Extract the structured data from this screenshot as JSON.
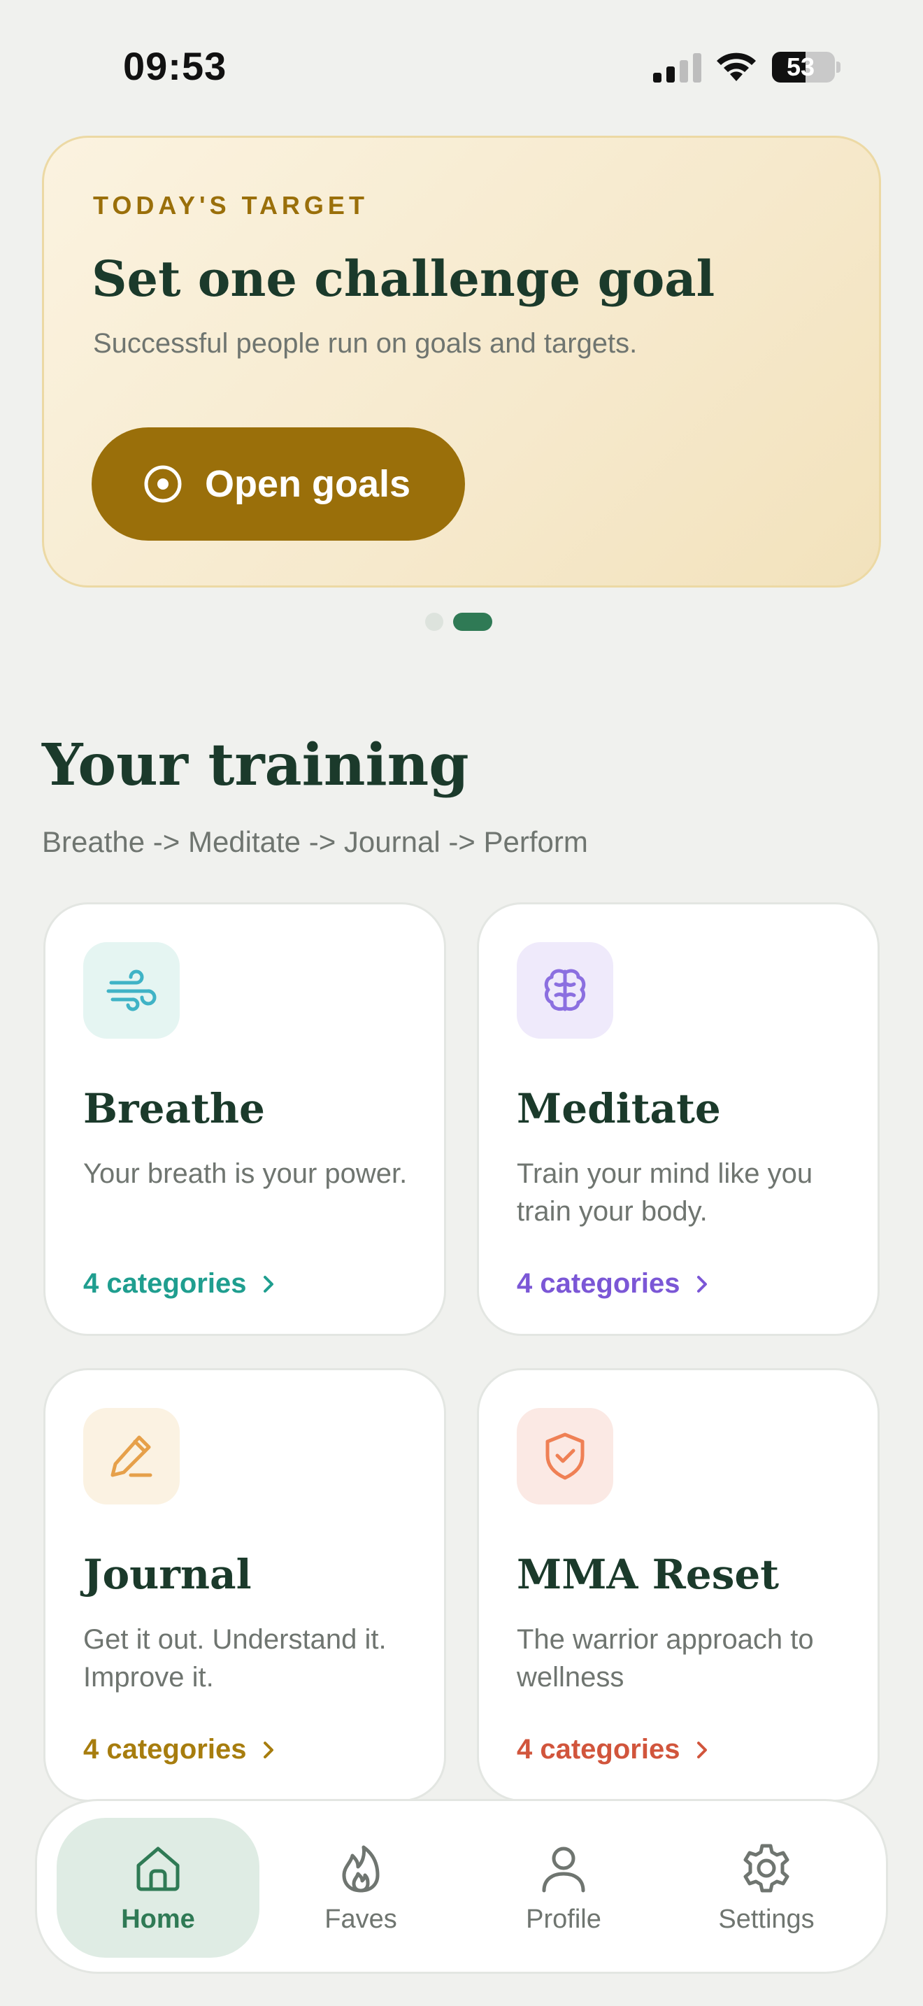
{
  "status_bar": {
    "time": "09:53",
    "battery": "53",
    "battery_level": 0.53
  },
  "target_card": {
    "kicker": "TODAY'S TARGET",
    "title": "Set one challenge goal",
    "subtitle": "Successful people run on goals and targets.",
    "button_label": "Open goals",
    "button_icon": "target-icon"
  },
  "carousel": {
    "pages": 2,
    "active_index": 1
  },
  "training": {
    "title": "Your training",
    "subtitle": "Breathe -> Meditate -> Journal -> Perform",
    "tiles": [
      {
        "title": "Breathe",
        "description": "Your breath is your power.",
        "link": "4 categories",
        "icon": "wind-icon",
        "accent": "#1f9e8f"
      },
      {
        "title": "Meditate",
        "description": "Train your mind like you train your body.",
        "link": "4 categories",
        "icon": "brain-icon",
        "accent": "#7b57d6"
      },
      {
        "title": "Journal",
        "description": "Get it out. Understand it. Improve it.",
        "link": "4 categories",
        "icon": "pencil-icon",
        "accent": "#a77d0e"
      },
      {
        "title": "MMA Reset",
        "description": "The warrior approach to wellness",
        "link": "4 categories",
        "icon": "shield-check-icon",
        "accent": "#d1553c"
      }
    ]
  },
  "nav": {
    "items": [
      {
        "label": "Home",
        "icon": "home-icon",
        "active": true
      },
      {
        "label": "Faves",
        "icon": "flame-icon",
        "active": false
      },
      {
        "label": "Profile",
        "icon": "user-icon",
        "active": false
      },
      {
        "label": "Settings",
        "icon": "gear-icon",
        "active": false
      }
    ]
  },
  "colors": {
    "brand_green": "#2f7a55",
    "gold": "#9a6f0a",
    "background": "#f0f1ee"
  }
}
